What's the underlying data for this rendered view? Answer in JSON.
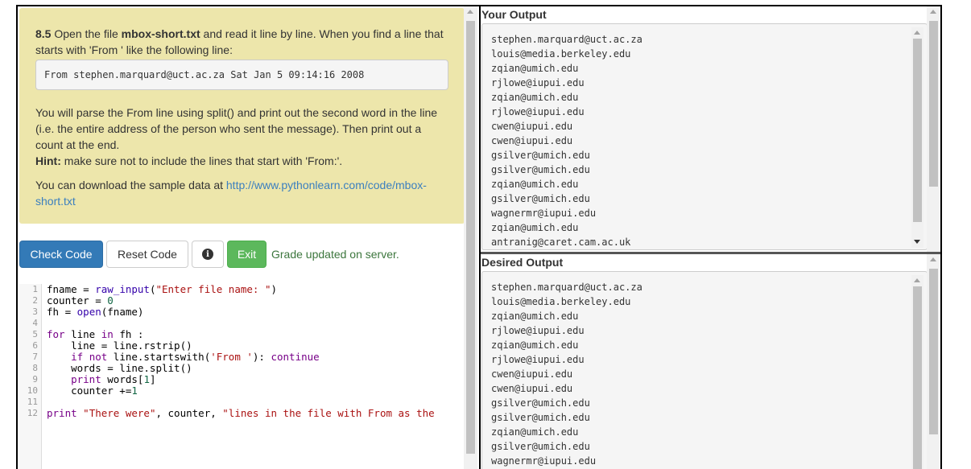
{
  "task": {
    "number": "8.5",
    "intro_a": " Open the file ",
    "filename": "mbox-short.txt",
    "intro_b": " and read it line by line. When you find a line that starts with 'From ' like the following line:",
    "sample_line": "From stephen.marquard@uct.ac.za Sat Jan  5 09:14:16 2008",
    "instructions": "You will parse the From line using split() and print out the second word in the line (i.e. the entire address of the person who sent the message). Then print out a count at the end.",
    "hint_label": "Hint:",
    "hint_text": " make sure not to include the lines that start with 'From:'.",
    "download_text": "You can download the sample data at ",
    "download_link": "http://www.pythonlearn.com/code/mbox-short.txt"
  },
  "toolbar": {
    "check_label": "Check Code",
    "reset_label": "Reset Code",
    "info_glyph": "i",
    "exit_label": "Exit",
    "status": "Grade updated on server."
  },
  "editor": {
    "line_numbers": [
      "1",
      "2",
      "3",
      "4",
      "5",
      "6",
      "7",
      "8",
      "9",
      "10",
      "11",
      "12"
    ],
    "lines": [
      "fname = raw_input(\"Enter file name: \")",
      "counter = 0",
      "fh = open(fname)",
      "",
      "for line in fh :",
      "    line = line.rstrip()",
      "    if not line.startswith('From '): continue",
      "    words = line.split()",
      "    print words[1]",
      "    counter +=1",
      "",
      "print \"There were\", counter, \"lines in the file with From as the"
    ]
  },
  "your_output": {
    "title": "Your Output",
    "lines": [
      "stephen.marquard@uct.ac.za",
      "louis@media.berkeley.edu",
      "zqian@umich.edu",
      "rjlowe@iupui.edu",
      "zqian@umich.edu",
      "rjlowe@iupui.edu",
      "cwen@iupui.edu",
      "cwen@iupui.edu",
      "gsilver@umich.edu",
      "gsilver@umich.edu",
      "zqian@umich.edu",
      "gsilver@umich.edu",
      "wagnermr@iupui.edu",
      "zqian@umich.edu",
      "antranig@caret.cam.ac.uk"
    ]
  },
  "desired_output": {
    "title": "Desired Output",
    "lines": [
      "stephen.marquard@uct.ac.za",
      "louis@media.berkeley.edu",
      "zqian@umich.edu",
      "rjlowe@iupui.edu",
      "zqian@umich.edu",
      "rjlowe@iupui.edu",
      "cwen@iupui.edu",
      "cwen@iupui.edu",
      "gsilver@umich.edu",
      "gsilver@umich.edu",
      "zqian@umich.edu",
      "gsilver@umich.edu",
      "wagnermr@iupui.edu"
    ]
  },
  "colors": {
    "task_bg": "#ede6ab",
    "primary": "#337ab7",
    "success": "#5cb85c",
    "status_text": "#3c763d",
    "link": "#3b7fbf"
  }
}
